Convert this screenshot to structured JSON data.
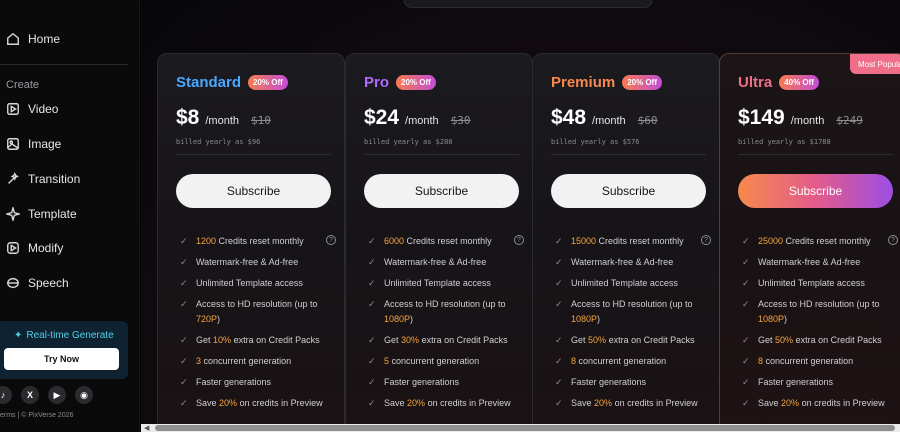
{
  "sidebar": {
    "nav": [
      {
        "label": "Home",
        "icon": "home-icon"
      },
      {
        "label": "Video",
        "icon": "video-icon"
      },
      {
        "label": "Image",
        "icon": "image-icon"
      },
      {
        "label": "Transition",
        "icon": "transition-icon"
      },
      {
        "label": "Template",
        "icon": "template-icon"
      },
      {
        "label": "Modify",
        "icon": "modify-icon"
      },
      {
        "label": "Speech",
        "icon": "speech-icon"
      }
    ],
    "section_label": "Create",
    "realtime": {
      "label": "Real-time Generate",
      "button": "Try Now"
    },
    "socials": [
      {
        "name": "tiktok-icon",
        "glyph": "♪"
      },
      {
        "name": "x-icon",
        "glyph": "X"
      },
      {
        "name": "youtube-icon",
        "glyph": "▶"
      },
      {
        "name": "discord-icon",
        "glyph": "◉"
      }
    ],
    "footer": "erms  |  © PixVerse 2026"
  },
  "plans": [
    {
      "name": "Standard",
      "name_color": "#4aa8ff",
      "badge": "20% Off",
      "price": "$8",
      "per": "/month",
      "old_price": "$10",
      "billed": "billed yearly as $96",
      "subscribe": "Subscribe",
      "credits": "1200",
      "hd_res": "720P",
      "extra": "10%",
      "concurrent": "3",
      "preview_save": "20%"
    },
    {
      "name": "Pro",
      "name_color": "#b06bff",
      "badge": "20% Off",
      "price": "$24",
      "per": "/month",
      "old_price": "$30",
      "billed": "billed yearly as $288",
      "subscribe": "Subscribe",
      "credits": "6000",
      "hd_res": "1080P",
      "extra": "30%",
      "concurrent": "5",
      "preview_save": "20%"
    },
    {
      "name": "Premium",
      "name_color": "#f7894c",
      "badge": "20% Off",
      "price": "$48",
      "per": "/month",
      "old_price": "$60",
      "billed": "billed yearly as $576",
      "subscribe": "Subscribe",
      "credits": "15000",
      "hd_res": "1080P",
      "extra": "50%",
      "concurrent": "8",
      "preview_save": "20%"
    },
    {
      "name": "Ultra",
      "name_color": "#ef6f8a",
      "badge": "40% Off",
      "price": "$149",
      "per": "/month",
      "old_price": "$249",
      "billed": "billed yearly as $1788",
      "subscribe": "Subscribe",
      "credits": "25000",
      "hd_res": "1080P",
      "extra": "50%",
      "concurrent": "8",
      "preview_save": "20%",
      "ribbon": "Most Popular"
    }
  ],
  "feature_text": {
    "credits_suffix": "Credits reset monthly",
    "watermark": "Watermark-free & Ad-free",
    "template": "Unlimited Template access",
    "hd_prefix": "Access to HD resolution (up to",
    "hd_suffix": ")",
    "extra_prefix": "Get",
    "extra_suffix": "extra on Credit Packs",
    "concurrent_suffix": "concurrent generation",
    "faster": "Faster generations",
    "save_prefix": "Save",
    "save_suffix": "on credits in Preview"
  },
  "colors": {
    "accent_orange": "#f5a43f",
    "ribbon": "#ef6f8a"
  }
}
